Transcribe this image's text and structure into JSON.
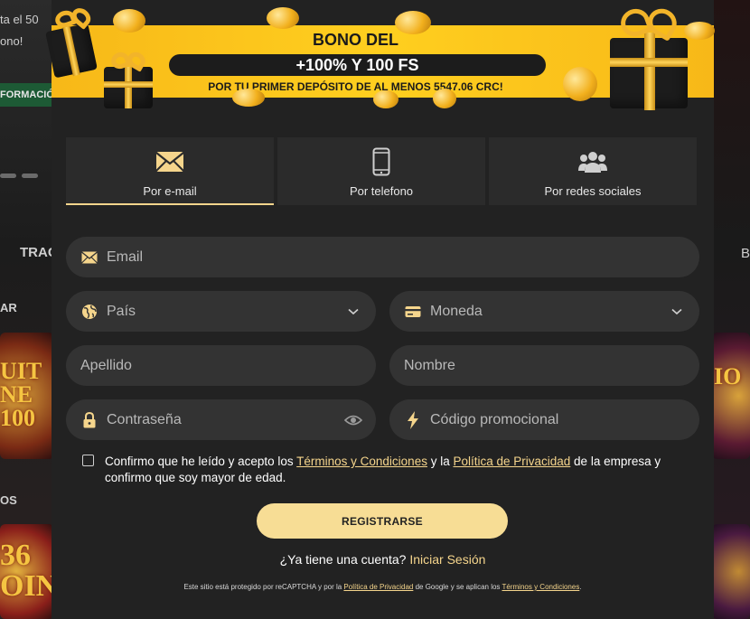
{
  "background": {
    "left_text_line1": "ta el 50",
    "left_text_line2": "ono!",
    "left_button": "FORMACIÓ",
    "left_nav": "TRAC",
    "left_section": "AR",
    "left_section2": "OS",
    "right_nav": "B",
    "card_a_label": "UIT NE 100",
    "card_b_label": "36 OIN",
    "card_c_label": "IO"
  },
  "banner": {
    "title": "BONO DEL",
    "highlight": "+100% Y 100 FS",
    "subtitle": "POR TU PRIMER DEPÓSITO DE AL MENOS 5547.06 CRC!"
  },
  "tabs": [
    {
      "label": "Por e-mail",
      "icon": "envelope-icon",
      "active": true
    },
    {
      "label": "Por telefono",
      "icon": "phone-icon",
      "active": false
    },
    {
      "label": "Por redes sociales",
      "icon": "users-icon",
      "active": false
    }
  ],
  "form": {
    "email_placeholder": "Email",
    "country_placeholder": "País",
    "currency_placeholder": "Moneda",
    "lastname_placeholder": "Apellido",
    "firstname_placeholder": "Nombre",
    "password_placeholder": "Contraseña",
    "promo_placeholder": "Código promocional"
  },
  "terms": {
    "text1": "Confirmo que he leído y acepto los ",
    "link_terms": "Términos y Condiciones",
    "text2": " y la ",
    "link_privacy": "Política de Privacidad",
    "text3": " de la empresa y confirmo que soy mayor de edad."
  },
  "register_label": "REGISTRARSE",
  "login": {
    "question": "¿Ya tiene una cuenta?",
    "link": "Iniciar Sesión"
  },
  "recaptcha": {
    "text1": "Este sitio está protegido por reCAPTCHA y por la ",
    "link_privacy": "Política de Privacidad",
    "text2": " de Google y se aplican los ",
    "link_terms": "Términos y Condiciones",
    "text3": "."
  },
  "colors": {
    "accent": "#f5d58c",
    "banner": "#ffcf1f",
    "modal": "#222222",
    "field": "#333333"
  }
}
